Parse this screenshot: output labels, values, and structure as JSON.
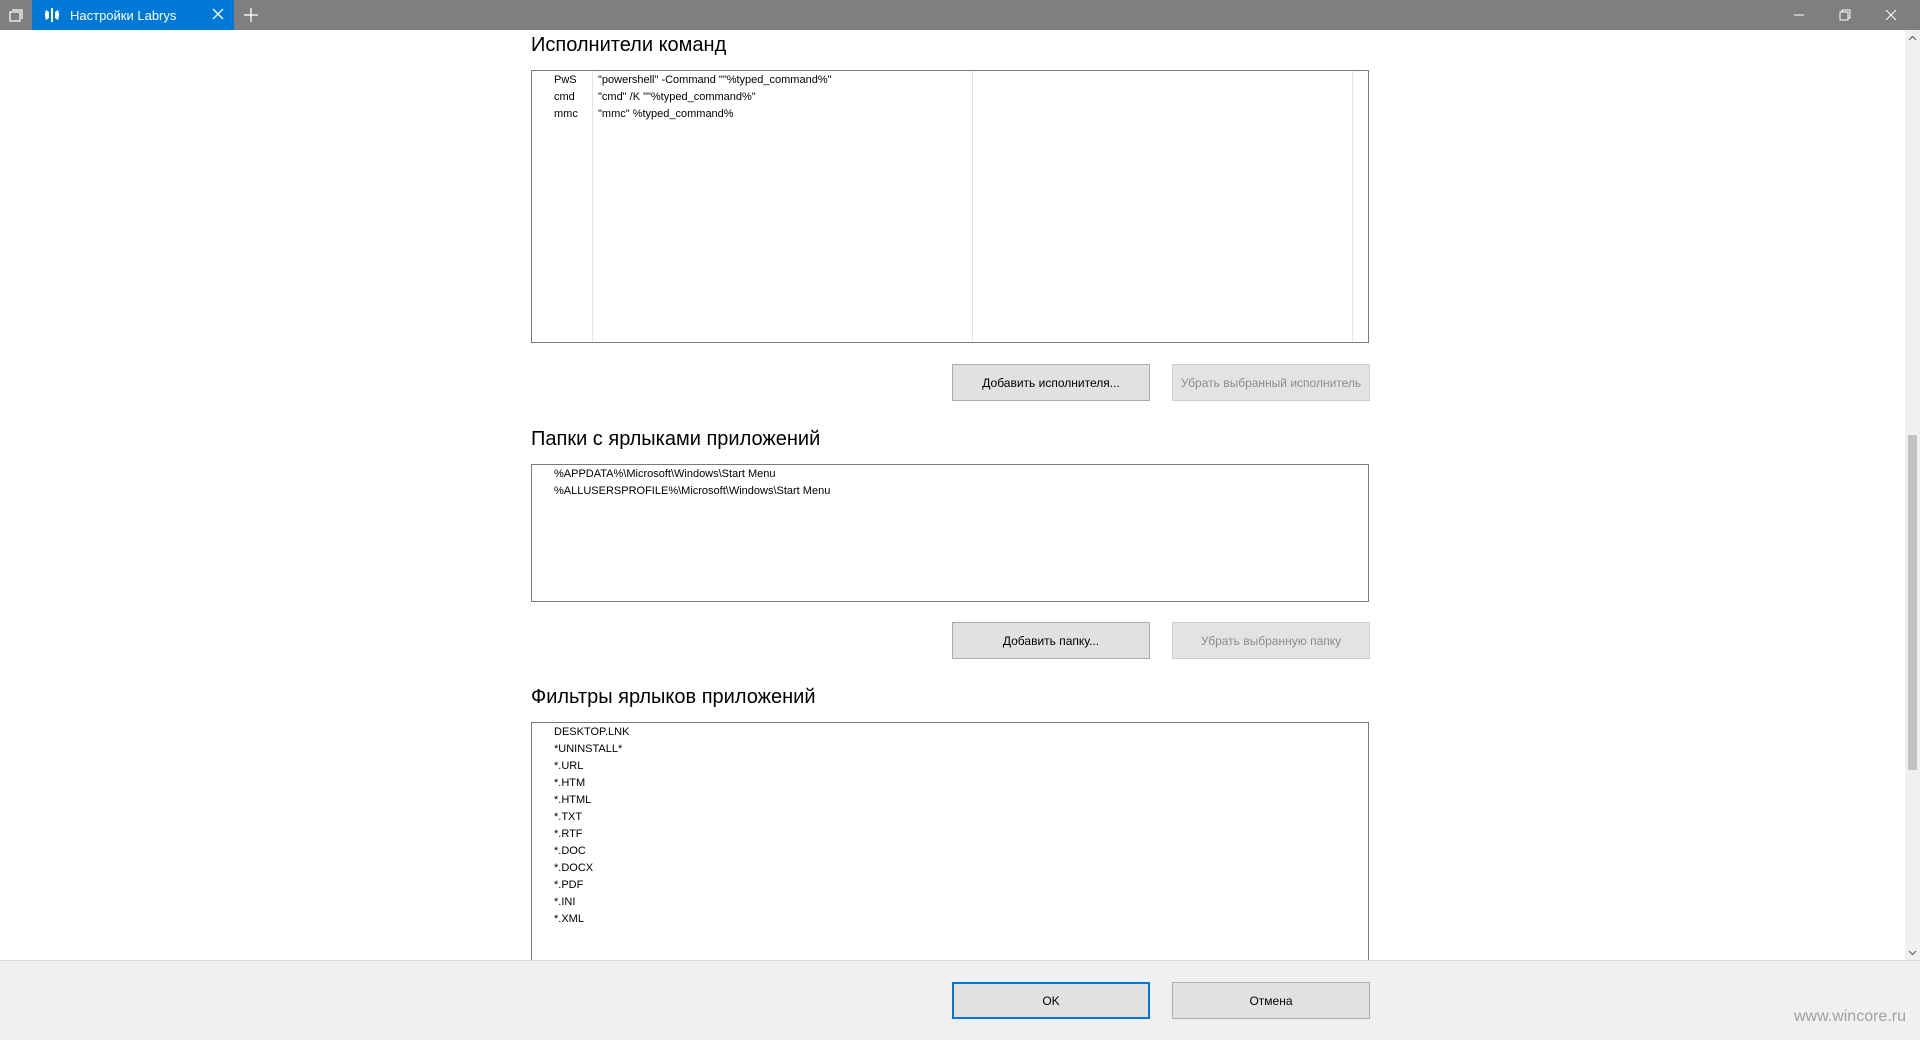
{
  "window": {
    "tab_title": "Настройки Labrys",
    "tab_icon": "labrys-app-icon",
    "accent_color": "#0078d7"
  },
  "executors": {
    "heading": "Исполнители команд",
    "rows": [
      {
        "name": "PwS",
        "command": "\"powershell\" -Command \"\"%typed_command%\""
      },
      {
        "name": "cmd",
        "command": "\"cmd\" /K \"\"%typed_command%\""
      },
      {
        "name": "mmc",
        "command": "\"mmc\" %typed_command%"
      }
    ],
    "add_label": "Добавить исполнителя...",
    "remove_label": "Убрать выбранный исполнитель"
  },
  "folders": {
    "heading": "Папки с ярлыками приложений",
    "items": [
      "%APPDATA%\\Microsoft\\Windows\\Start Menu",
      "%ALLUSERSPROFILE%\\Microsoft\\Windows\\Start Menu"
    ],
    "add_label": "Добавить папку...",
    "remove_label": "Убрать выбранную папку"
  },
  "filters": {
    "heading": "Фильтры ярлыков приложений",
    "items": [
      "DESKTOP.LNK",
      "*UNINSTALL*",
      "*.URL",
      "*.HTM",
      "*.HTML",
      "*.TXT",
      "*.RTF",
      "*.DOC",
      "*.DOCX",
      "*.PDF",
      "*.INI",
      "*.XML"
    ]
  },
  "footer": {
    "ok_label": "OK",
    "cancel_label": "Отмена",
    "watermark": "www.wincore.ru"
  }
}
